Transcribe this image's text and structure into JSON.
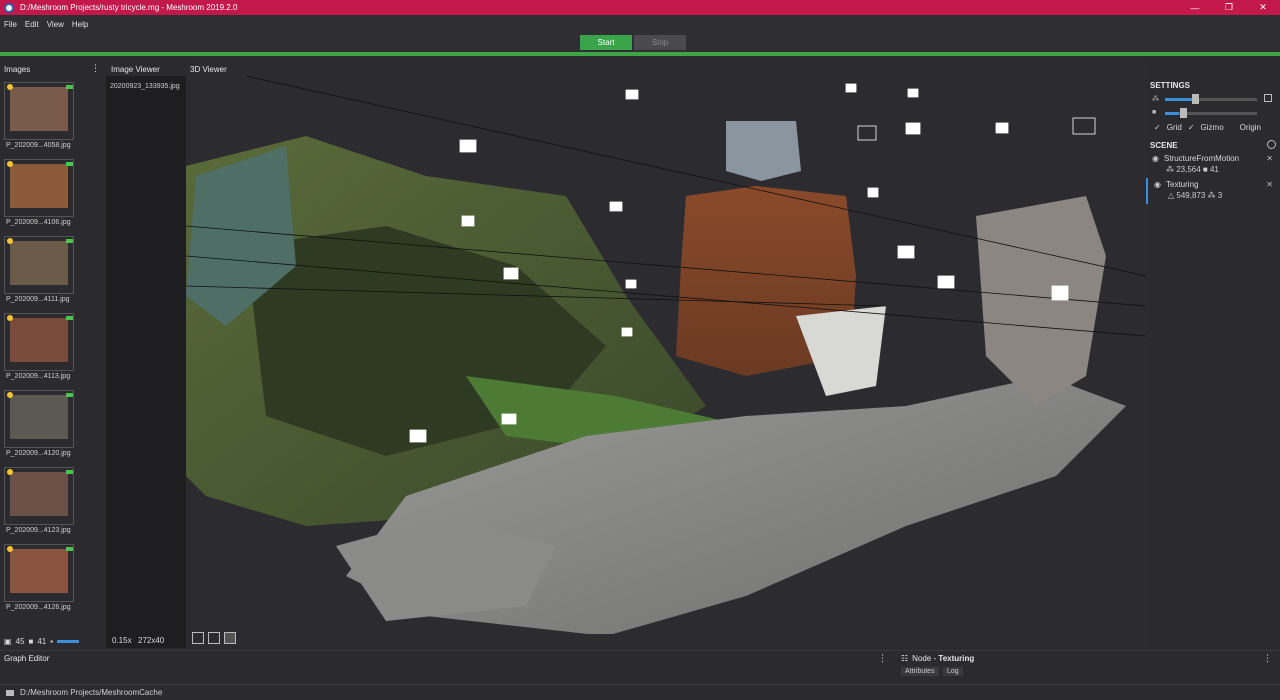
{
  "window": {
    "title": "D:/Meshroom Projects/rusty tricycle.mg - Meshroom 2019.2.0",
    "controls": [
      "—",
      "❐",
      "✕"
    ]
  },
  "menu": [
    "File",
    "Edit",
    "View",
    "Help"
  ],
  "toolbar": {
    "start_label": "Start",
    "stop_label": "Stop",
    "progress_fraction": 1.0
  },
  "images_panel": {
    "title": "Images",
    "thumbnails": [
      {
        "label": "P_202009...4058.jpg",
        "color": "#7a5a4a"
      },
      {
        "label": "P_202009...4106.jpg",
        "color": "#8a5a3a"
      },
      {
        "label": "P_202009...4111.jpg",
        "color": "#6a5a48"
      },
      {
        "label": "P_202009...4113.jpg",
        "color": "#7a4a3a"
      },
      {
        "label": "P_202009...4120.jpg",
        "color": "#5a5a52"
      },
      {
        "label": "P_202009...4123.jpg",
        "color": "#6a5046"
      },
      {
        "label": "P_202009...4126.jpg",
        "color": "#8a5440"
      }
    ],
    "footer": {
      "image_count": "45",
      "camera_count": "41"
    }
  },
  "image_viewer": {
    "title": "Image Viewer",
    "filename": "20200923_133935.jpg",
    "zoom": "0.15x",
    "resolution": "272x40"
  },
  "viewer_3d": {
    "title": "3D Viewer"
  },
  "settings": {
    "title": "SETTINGS",
    "checks": [
      "Grid",
      "Gizmo",
      "Origin"
    ],
    "scene_title": "SCENE",
    "scene_items": [
      {
        "name": "StructureFromMotion",
        "stats": "⁂ 23,564 ■ 41"
      },
      {
        "name": "Texturing",
        "stats": "△ 549,873 ⁂ 3"
      }
    ]
  },
  "graph_editor": {
    "title": "Graph Editor"
  },
  "node_panel": {
    "prefix": "Node - ",
    "node_name": "Texturing",
    "tabs": [
      "Attributes",
      "Log"
    ]
  },
  "statusbar": {
    "path": "D:/Meshroom Projects/MeshroomCache"
  },
  "colors": {
    "titlebar": "#c2184c",
    "progress": "#3fa646",
    "start": "#3aa44a",
    "accent": "#3a8fd8"
  }
}
